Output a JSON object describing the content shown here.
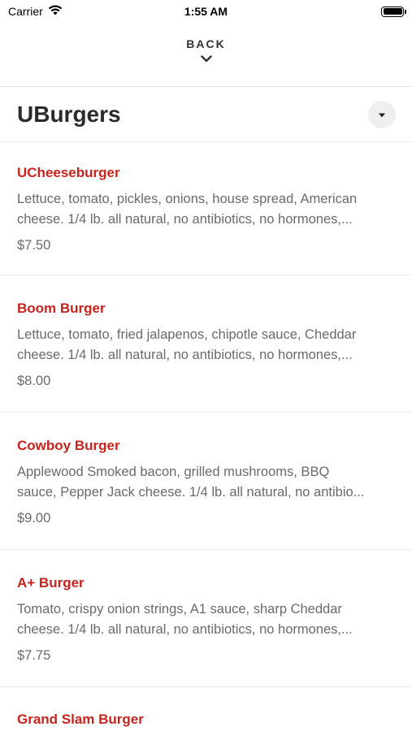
{
  "status_bar": {
    "carrier": "Carrier",
    "time": "1:55 AM",
    "battery_level": 1.0
  },
  "nav": {
    "back_label": "BACK"
  },
  "section": {
    "title": "UBurgers"
  },
  "items": [
    {
      "name": "UCheeseburger",
      "desc_line1": "Lettuce, tomato, pickles, onions, house spread, American",
      "desc_line2": "cheese. 1/4 lb. all natural, no antibiotics, no hormones,...",
      "price": "$7.50"
    },
    {
      "name": "Boom Burger",
      "desc_line1": "Lettuce, tomato, fried jalapenos, chipotle sauce, Cheddar",
      "desc_line2": "cheese. 1/4 lb. all natural, no antibiotics, no hormones,...",
      "price": "$8.00"
    },
    {
      "name": "Cowboy Burger",
      "desc_line1": "Applewood Smoked bacon, grilled mushrooms, BBQ",
      "desc_line2": "sauce, Pepper Jack cheese. 1/4 lb. all natural, no antibio...",
      "price": "$9.00"
    },
    {
      "name": "A+ Burger",
      "desc_line1": "Tomato, crispy onion strings, A1 sauce, sharp Cheddar",
      "desc_line2": "cheese. 1/4 lb. all natural, no antibiotics, no hormones,...",
      "price": "$7.75"
    },
    {
      "name": "Grand Slam Burger"
    }
  ],
  "colors": {
    "accent": "#c9231d",
    "text_secondary": "#6a6a6a"
  },
  "icons": {
    "wifi": "wifi-icon",
    "battery": "battery-icon",
    "back_chevron": "chevron-down-icon",
    "dropdown": "caret-down-icon"
  }
}
